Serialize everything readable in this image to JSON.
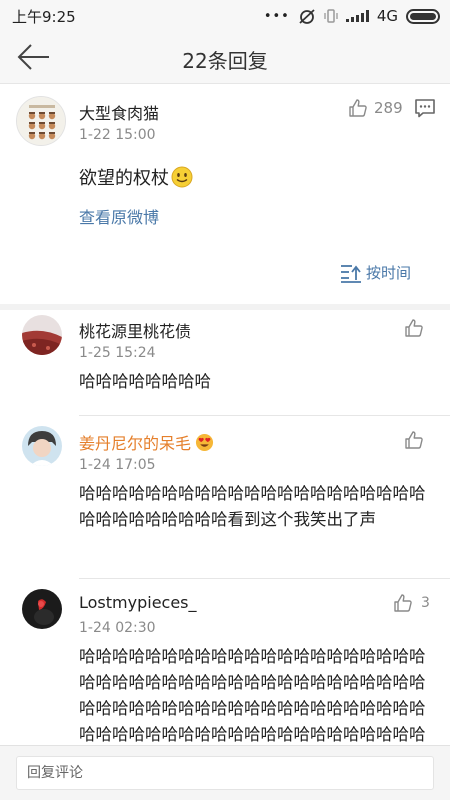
{
  "status_bar": {
    "time": "上午9:25",
    "network": "4G"
  },
  "header": {
    "title": "22条回复"
  },
  "post": {
    "user": "大型食肉猫",
    "time": "1-22 15:00",
    "likes": "289",
    "text": "欲望的权杖",
    "view_original": "查看原微博",
    "sort_label": "按时间"
  },
  "comments": [
    {
      "user": "桃花源里桃花债",
      "time": "1-25 15:24",
      "text": "哈哈哈哈哈哈哈哈",
      "likes": ""
    },
    {
      "user": "姜丹尼尔的呆毛",
      "time": "1-24 17:05",
      "text": "哈哈哈哈哈哈哈哈哈哈哈哈哈哈哈哈哈哈哈哈哈哈哈哈哈哈哈哈哈哈看到这个我笑出了声",
      "likes": ""
    },
    {
      "user": "Lostmypieces_",
      "time": "1-24 02:30",
      "text": "哈哈哈哈哈哈哈哈哈哈哈哈哈哈哈哈哈哈哈哈哈哈哈哈哈哈哈哈哈哈哈哈哈哈哈哈哈哈哈哈哈哈哈哈哈哈哈哈哈哈哈哈哈哈哈哈哈哈哈哈哈哈哈哈哈哈哈哈哈哈哈哈哈哈哈哈哈哈哈哈哈哈哈哈哈哈哈哈哈哈哈哈哈哈哈哈哈哈哈哈哈哈哈哈哈哈",
      "likes": "3"
    }
  ],
  "reply": {
    "placeholder": "回复评论"
  },
  "colors": {
    "link": "#4a78a8",
    "vip_name": "#e57f2b",
    "muted": "#8a8a8a",
    "background": "#f7f7f7"
  },
  "icons": [
    "back-arrow-icon",
    "thumbs-up-icon",
    "comment-icon",
    "sort-icon",
    "smiley-emoji-icon",
    "heart-eyes-emoji-icon"
  ]
}
